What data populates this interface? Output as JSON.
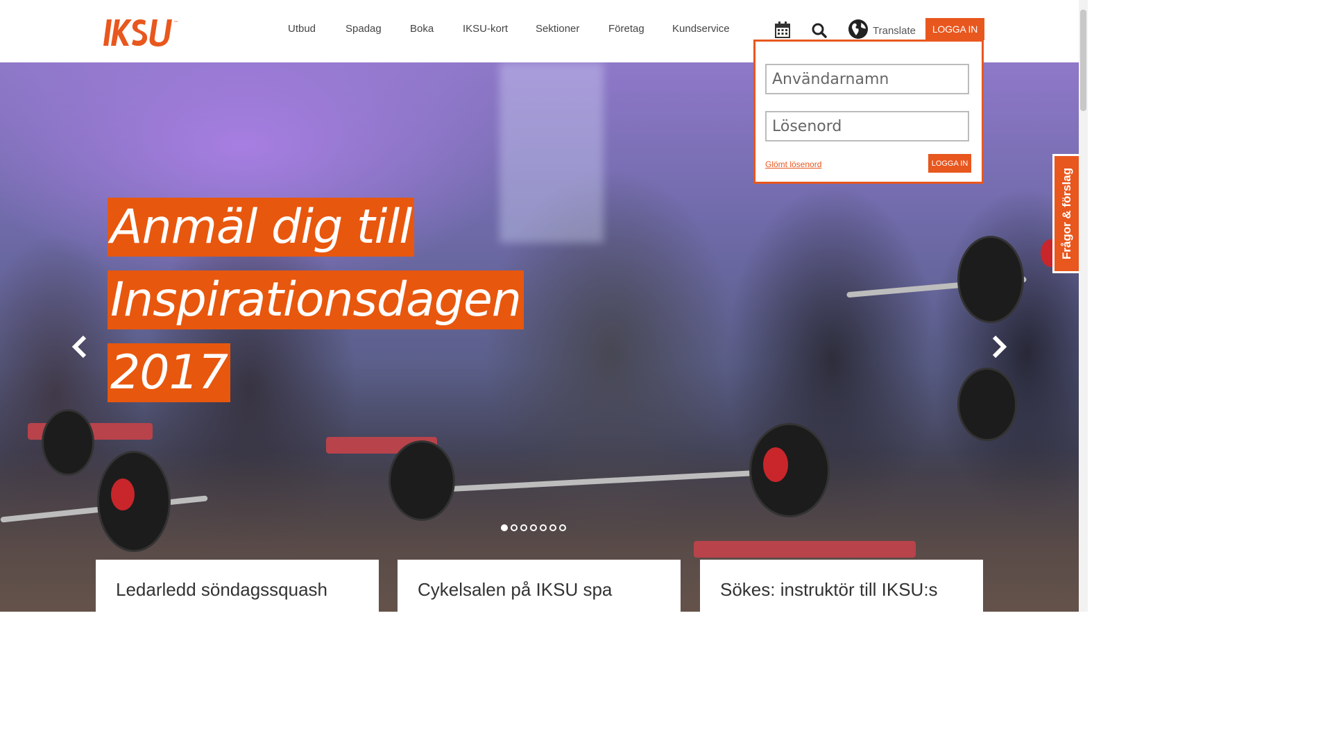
{
  "header": {
    "logo_text": "IKSU",
    "nav": [
      "Utbud",
      "Spadag",
      "Boka",
      "IKSU-kort",
      "Sektioner",
      "Företag",
      "Kundservice"
    ],
    "calendar_icon": "calendar-icon",
    "search_icon": "search-icon",
    "globe_icon": "globe-icon",
    "translate_label": "Translate",
    "login_label": "LOGGA IN"
  },
  "login_popup": {
    "username_placeholder": "Användarnamn",
    "username_value": "",
    "password_placeholder": "Lösenord",
    "password_value": "",
    "forgot_label": "Glömt lösenord",
    "submit_label": "LOGGA IN"
  },
  "hero": {
    "headline_lines": [
      "Anmäl dig till",
      "Inspirationsdagen",
      "2017"
    ],
    "prev_icon": "chevron-left-icon",
    "next_icon": "chevron-right-icon",
    "slide_count": 7,
    "active_slide": 1
  },
  "cards": [
    {
      "title": "Ledarledd söndagssquash"
    },
    {
      "title": "Cykelsalen på IKSU spa"
    },
    {
      "title": "Sökes: instruktör till IKSU:s"
    }
  ],
  "side_tab": {
    "label": "Frågor & förslag"
  },
  "colors": {
    "accent": "#e8571e",
    "text": "#444444"
  }
}
